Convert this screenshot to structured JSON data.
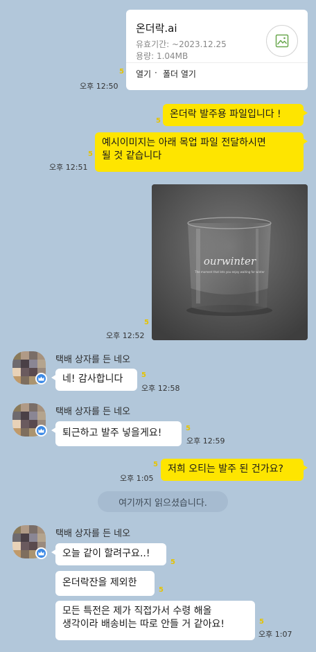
{
  "file_card": {
    "filename": "온더락.ai",
    "expiry": "유효기간: ~2023.12.25",
    "size": "용량: 1.04MB",
    "open_label": "열기",
    "separator": "·",
    "open_folder_label": "폴더 열기",
    "icon": "image-file-icon",
    "unread": "5",
    "time": "오후 12:50"
  },
  "messages_me": [
    {
      "text": "온더락 발주용 파일입니다 !",
      "unread": "5"
    },
    {
      "text_line1": "예시이미지는 아래 목업 파일 전달하시면",
      "text_line2": "될 것 같습니다",
      "unread": "5",
      "time": "오후 12:51"
    }
  ],
  "photo": {
    "brand_text": "ourwinter",
    "tagline": "The moment that lets you enjoy waiting for winter",
    "unread": "5",
    "time": "오후 12:52"
  },
  "sender_name": "택배 상자를 든 네오",
  "neo_1": {
    "text": "네! 감사합니다",
    "unread": "5",
    "time": "오후 12:58"
  },
  "neo_2": {
    "text": "퇴근하고 발주 넣을게요!",
    "unread": "5",
    "time": "오후 12:59"
  },
  "me_3": {
    "text": "저희 오티는 발주 된 건가요?",
    "unread": "5",
    "time": "오후 1:05"
  },
  "divider": {
    "text": "여기까지 읽으셨습니다."
  },
  "neo_3": {
    "msg1": "오늘 같이 할려구요..!",
    "msg2": "온더락잔을 제외한",
    "msg3_line1": "모든 특전은 제가 직접가서 수령 해올",
    "msg3_line2": "생각이라 배송비는 따로 안들 거 같아요!",
    "unread": "5",
    "time": "오후 1:07"
  },
  "colors": {
    "background": "#b2c7da",
    "my_bubble": "#fee500",
    "their_bubble": "#ffffff",
    "unread_count": "#e6c300",
    "crown_badge": "#3d8ae6"
  }
}
